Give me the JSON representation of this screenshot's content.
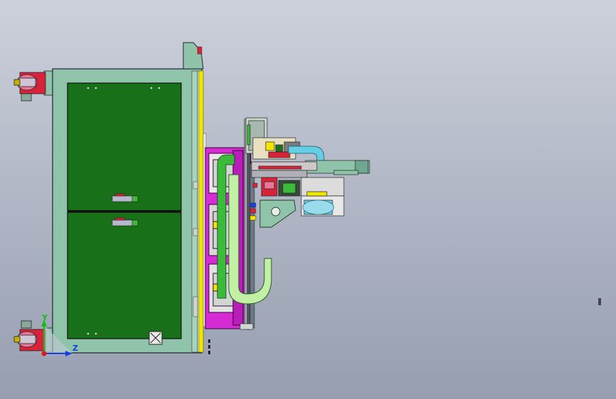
{
  "window": {
    "title": ""
  },
  "triad": {
    "y_label": "Y",
    "z_label": "Z"
  },
  "colors": {
    "background_top": "#ccd1db",
    "background_bottom": "#969eb0",
    "cabinet_frame": "#8fc4aa",
    "door_panel": "#187018",
    "magenta_frame": "#d42bd4",
    "yellow_strip": "#f2e600",
    "cable_chain": "#c2f0a4",
    "cyan_parts": "#66cfe6",
    "red_parts": "#d8233a",
    "axis_y": "#18b818",
    "axis_z": "#1a3fe0",
    "axis_x": "#e01818"
  }
}
